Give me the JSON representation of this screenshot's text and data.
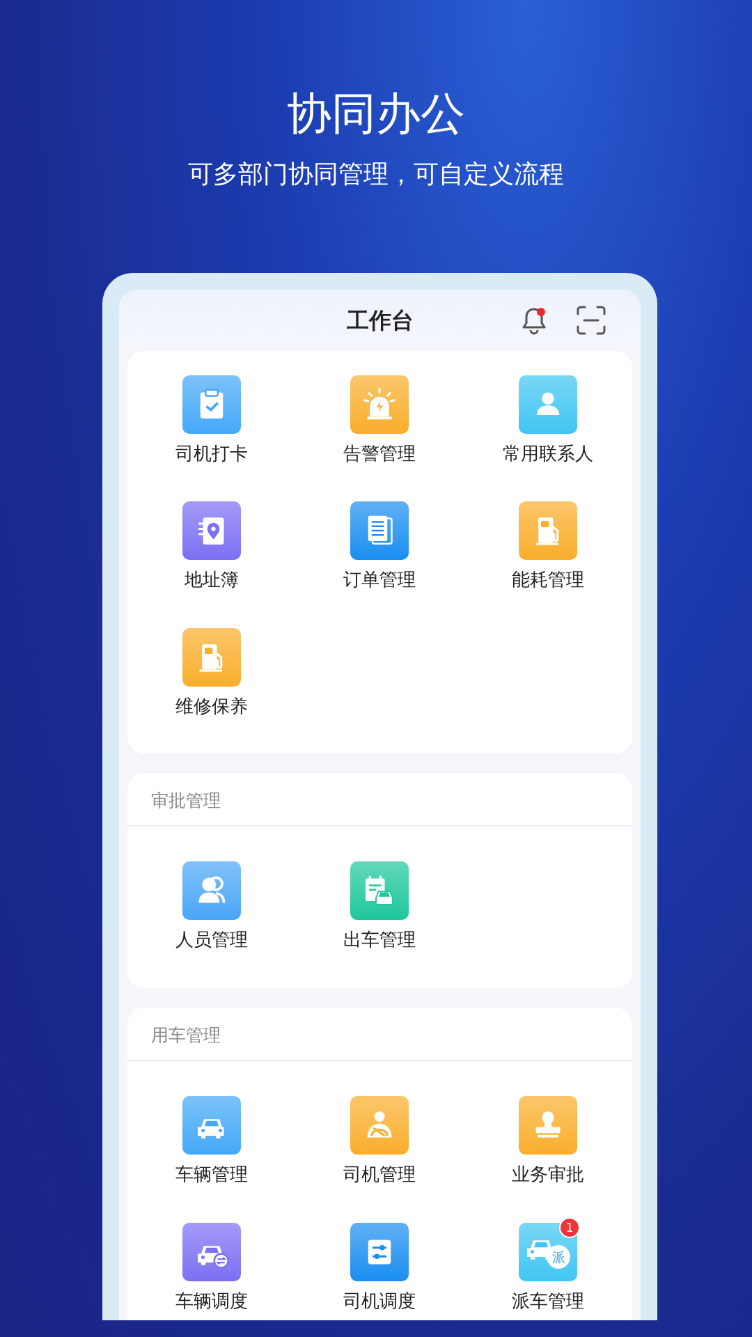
{
  "headline": "协同办公",
  "subheadline": "可多部门协同管理，可自定义流程",
  "app": {
    "title": "工作台",
    "notification_unread": true,
    "sections": [
      {
        "items": [
          {
            "label": "司机打卡",
            "kind": "clipboard",
            "color": "#44a8f8"
          },
          {
            "label": "告警管理",
            "kind": "alarm",
            "color": "#f9ae2c"
          },
          {
            "label": "常用联系人",
            "kind": "person",
            "color": "#40c6f2"
          },
          {
            "label": "地址簿",
            "kind": "address",
            "color": "#7d6ff3"
          },
          {
            "label": "订单管理",
            "kind": "document",
            "color": "#1a8ef0"
          },
          {
            "label": "能耗管理",
            "kind": "fuel",
            "color": "#f9ae2c"
          },
          {
            "label": "维修保养",
            "kind": "fuel",
            "color": "#f9ae2c"
          }
        ]
      },
      {
        "title": "审批管理",
        "items": [
          {
            "label": "人员管理",
            "kind": "people",
            "color": "#4aa6f8"
          },
          {
            "label": "出车管理",
            "kind": "calendar-car",
            "color": "#1ec79b"
          }
        ]
      },
      {
        "title": "用车管理",
        "items": [
          {
            "label": "车辆管理",
            "kind": "car",
            "color": "#44a8f8"
          },
          {
            "label": "司机管理",
            "kind": "driver",
            "color": "#f9ae2c"
          },
          {
            "label": "业务审批",
            "kind": "stamp",
            "color": "#f9ae2c"
          },
          {
            "label": "车辆调度",
            "kind": "car-swap",
            "color": "#7d6ff3"
          },
          {
            "label": "司机调度",
            "kind": "sliders",
            "color": "#1a8ef0"
          },
          {
            "label": "派车管理",
            "kind": "car-dispatch",
            "color": "#40c6f2",
            "glyph": "派",
            "badge": "1"
          }
        ]
      }
    ]
  }
}
